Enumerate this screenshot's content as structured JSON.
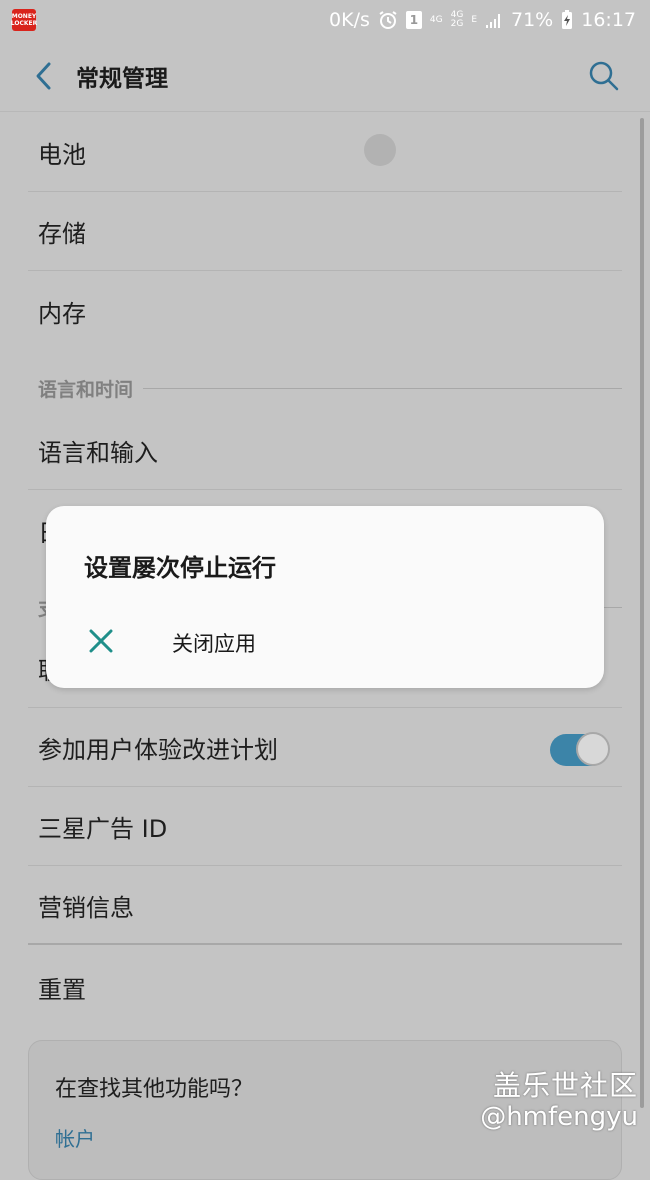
{
  "status_bar": {
    "app_badge_line1": "MONEY",
    "app_badge_line2": "LOCKER",
    "net_speed": "0K/s",
    "sim_badge": "1",
    "net_4g_a": "4G",
    "net_4g_b": "4G",
    "net_2g": "2G",
    "net_e": "E",
    "battery": "71%",
    "time": "16:17"
  },
  "header": {
    "title": "常规管理"
  },
  "list": {
    "items": [
      {
        "label": "电池"
      },
      {
        "label": "存储"
      },
      {
        "label": "内存"
      }
    ],
    "section_language": "语言和时间",
    "language_input": "语言和输入",
    "partial_row_char": "日",
    "partial_section_char": "支",
    "partial_row2_char": "联",
    "experience_program": "参加用户体验改进计划",
    "experience_program_enabled": true,
    "ad_id": "三星广告 ID",
    "marketing": "营销信息",
    "reset": "重置"
  },
  "card": {
    "title": "在查找其他功能吗？",
    "link": "帐户"
  },
  "dialog": {
    "title": "设置屡次停止运行",
    "option_label": "关闭应用"
  },
  "watermark": {
    "line1": "盖乐世社区",
    "line2": "@hmfengyu"
  },
  "colors": {
    "accent": "#3c84a8",
    "dialog_icon": "#1f8f8a",
    "background_dimmed": "#c4c4c4"
  }
}
